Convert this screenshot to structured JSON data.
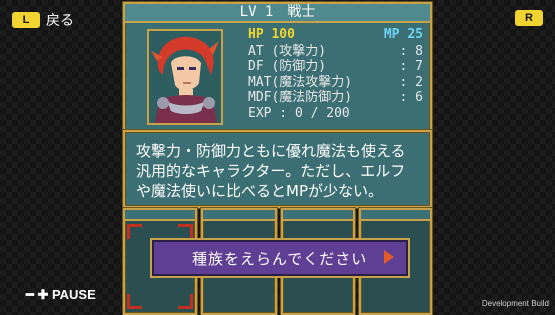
{
  "top_left": {
    "key": "L",
    "label": "戻る"
  },
  "top_right": {
    "key": "R"
  },
  "character": {
    "title": "LV 1　戦士",
    "hp_label": "HP 100",
    "mp_label": "MP 25",
    "stats": [
      {
        "name": "AT (攻撃力)",
        "value": ": 8"
      },
      {
        "name": "DF (防御力)",
        "value": ": 7"
      },
      {
        "name": "MAT(魔法攻撃力)",
        "value": ": 2"
      },
      {
        "name": "MDF(魔法防御力)",
        "value": ": 6"
      }
    ],
    "exp": "EXP : 0 / 200",
    "portrait_hair": "#d43a2a"
  },
  "description": {
    "line1": "攻撃力・防御力ともに優れ魔法も使える",
    "line2": "汎用的なキャラクター。ただし、エルフ",
    "line3": "や魔法使いに比べるとMPが少ない。"
  },
  "prompt": {
    "text": "種族をえらんでください"
  },
  "footer": {
    "pause": "━ ✚ PAUSE",
    "dev": "Development Build"
  },
  "colors": {
    "gold": "#c8a24a",
    "panel": "#3b6f73",
    "prompt": "#5f3f94"
  }
}
